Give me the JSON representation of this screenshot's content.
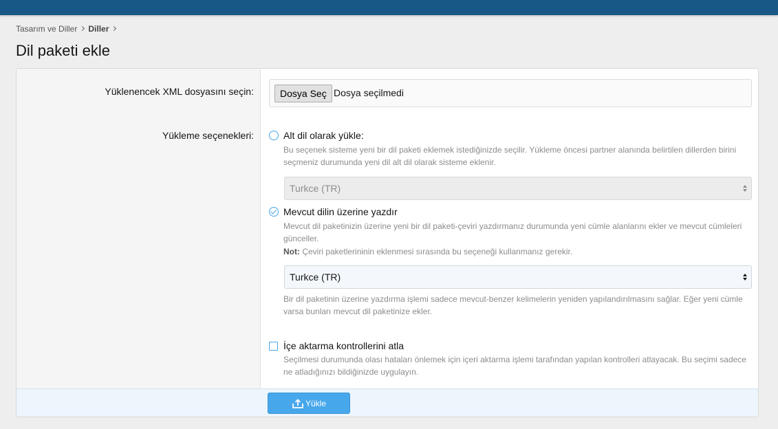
{
  "breadcrumb": [
    {
      "label": "Tasarım ve Diller"
    },
    {
      "label": "Diller"
    }
  ],
  "page_title": "Dil paketi ekle",
  "file_upload": {
    "label": "Yüklenencek XML dosyasını seçin:",
    "button_label": "Dosya Seç",
    "status": "Dosya seçilmedi"
  },
  "upload_options": {
    "label": "Yükleme seçenekleri:",
    "sub_language": {
      "title": "Alt dil olarak yükle:",
      "description": "Bu seçenek sisteme yeni bir dil paketi eklemek istediğinizde seçilir. Yükleme öncesi partner alanında belirtilen dillerden birini seçmeniz durumunda yeni dil alt dil olarak sisteme eklenir.",
      "selected": false,
      "select_value": "Turkce (TR)"
    },
    "overwrite": {
      "title": "Mevcut dilin üzerine yazdır",
      "description": "Mevcut dil paketinizin üzerine yeni bir dil paketi-çeviri yazdırmanız durumunda yeni cümle alanlarını ekler ve mevcut cümleleri günceller.",
      "note_label": "Not:",
      "note_text": " Çeviri paketlerininin eklenmesi sırasında bu seçeneği kullanmanız gerekir.",
      "selected": true,
      "select_value": "Turkce (TR)",
      "after_description": "Bir dil paketinin üzerine yazdırma işlemi sadece mevcut-benzer kelimelerin yeniden yapılandırılmasını sağlar. Eğer yeni cümle varsa bunları mevcut dil paketinize ekler."
    },
    "skip_checks": {
      "title": "İçe aktarma kontrollerini atla",
      "description": "Seçilmesi durumunda olası hataları önlemek için içeri aktarma işlemi tarafından yapılan kontrolleri atlayacak. Bu seçimi sadece ne atladığınızı bildiğinizde uygulayın.",
      "checked": false
    }
  },
  "submit": {
    "label": "Yükle",
    "icon": "upload-icon"
  },
  "colors": {
    "topbar": "#185886",
    "accent": "#47a7eb",
    "footer": "#edf5fd"
  }
}
